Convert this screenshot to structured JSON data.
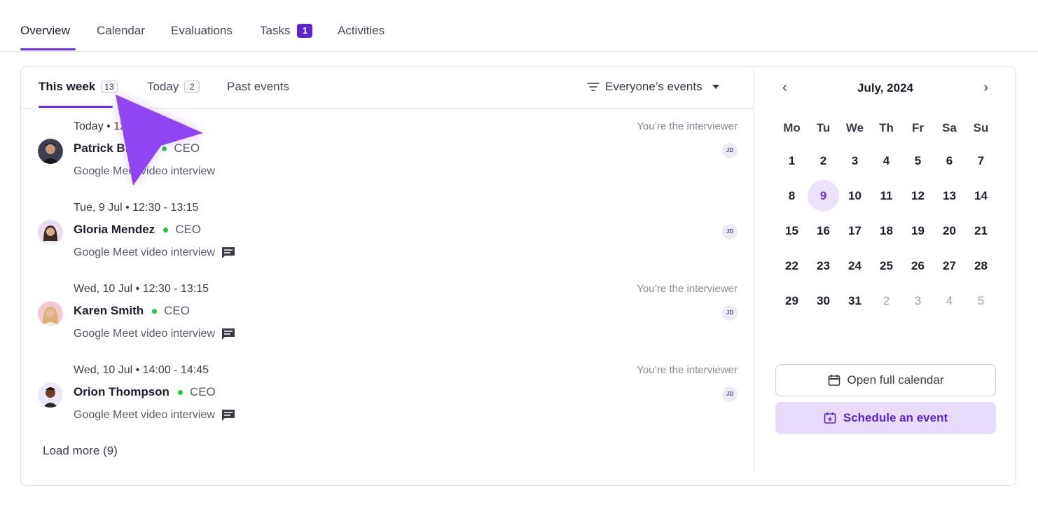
{
  "top_tabs": [
    {
      "label": "Overview"
    },
    {
      "label": "Calendar"
    },
    {
      "label": "Evaluations"
    },
    {
      "label": "Tasks",
      "badge": "1"
    },
    {
      "label": "Activities"
    }
  ],
  "sub_tabs": [
    {
      "label": "This week",
      "count": "13"
    },
    {
      "label": "Today",
      "count": "2"
    },
    {
      "label": "Past events"
    }
  ],
  "filter": {
    "label": "Everyone’s events"
  },
  "events": [
    {
      "time": "Today • 12:30 - 13:15",
      "name": "Patrick Brown",
      "role": "CEO",
      "meta": "Google Meet video interview",
      "note": "You’re the interviewer",
      "badge": "JD"
    },
    {
      "time": "Tue, 9 Jul • 12:30 - 13:15",
      "name": "Gloria Mendez",
      "role": "CEO",
      "meta": "Google Meet video interview",
      "note": "",
      "badge": "JD"
    },
    {
      "time": "Wed, 10 Jul • 12:30 - 13:15",
      "name": "Karen Smith",
      "role": "CEO",
      "meta": "Google Meet video interview",
      "note": "You’re the interviewer",
      "badge": "JD"
    },
    {
      "time": "Wed, 10 Jul • 14:00 - 14:45",
      "name": "Orion Thompson",
      "role": "CEO",
      "meta": "Google Meet video interview",
      "note": "You’re the interviewer",
      "badge": "JD"
    }
  ],
  "load_more": "Load more (9)",
  "calendar": {
    "title": "July, 2024",
    "prev": "‹",
    "next": "›",
    "weekdays": [
      "Mo",
      "Tu",
      "We",
      "Th",
      "Fr",
      "Sa",
      "Su"
    ],
    "weeks": [
      [
        "1",
        "2",
        "3",
        "4",
        "5",
        "6",
        "7"
      ],
      [
        "8",
        "9",
        "10",
        "11",
        "12",
        "13",
        "14"
      ],
      [
        "15",
        "16",
        "17",
        "18",
        "19",
        "20",
        "21"
      ],
      [
        "22",
        "23",
        "24",
        "25",
        "26",
        "27",
        "28"
      ],
      [
        "29",
        "30",
        "31",
        "2",
        "3",
        "4",
        "5"
      ]
    ],
    "selected_day": "9",
    "open_label": "Open full calendar",
    "schedule_label": "Schedule an event"
  },
  "colors": {
    "accent": "#6a2fd6",
    "online": "#2fbf3f"
  }
}
